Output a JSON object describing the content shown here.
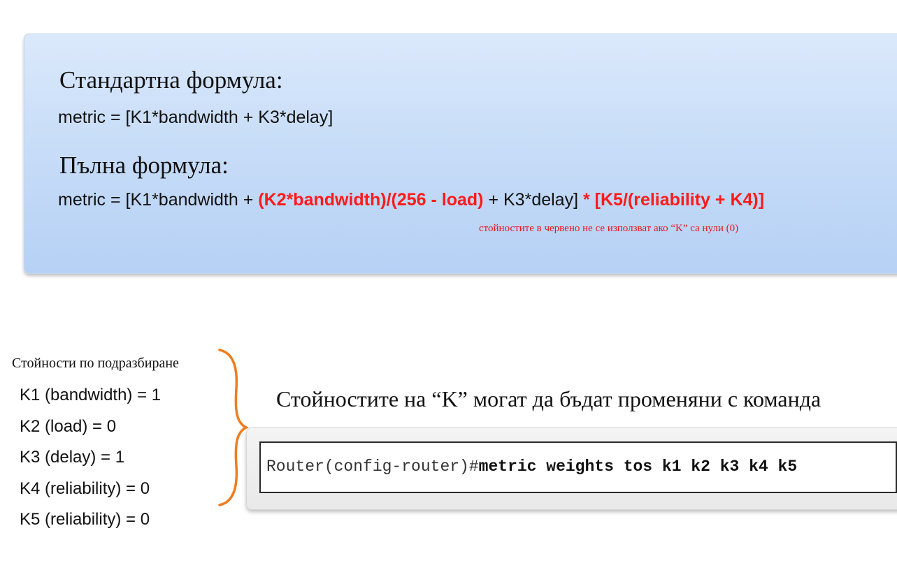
{
  "formula_panel": {
    "standard_heading": "Стандартна формула:",
    "standard_formula": "metric = [K1*bandwidth + K3*delay]",
    "full_heading": "Пълна формула:",
    "full_formula": {
      "part1": "metric = [K1*bandwidth + ",
      "part2_red": "(K2*bandwidth)/(256 - load)",
      "part3": " + K3*delay] ",
      "part4_red": "* [K5/(reliability + K4)]"
    },
    "red_note": "стойностите в червено не се използват ако “K” са нули (0)"
  },
  "defaults": {
    "title": "Стойности по подразбиране",
    "items": [
      "K1 (bandwidth) = 1",
      "K2 (load) = 0",
      "K3 (delay) = 1",
      "K4 (reliability) = 0",
      "K5 (reliability) = 0"
    ]
  },
  "command": {
    "caption": "Стойностите на “K” могат да бъдат променяни с команда",
    "prompt": "Router(config-router)#",
    "text": "metric weights tos k1 k2 k3 k4 k5"
  },
  "colors": {
    "red": "#ff1a1a",
    "brace": "#f07c1e",
    "panel_top": "#dbe9fb",
    "panel_bottom": "#b6d1f5"
  }
}
